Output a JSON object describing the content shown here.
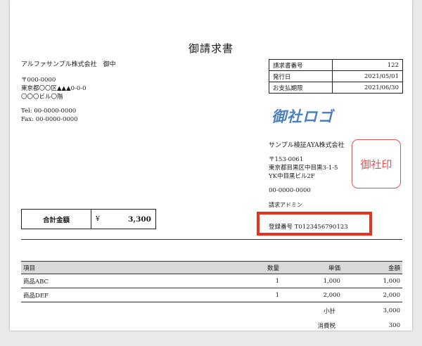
{
  "document": {
    "title": "御請求書",
    "client": {
      "name": "アルファサンプル株式会社　御中",
      "postal": "〒000-0000",
      "address1": "東京都〇〇区▲▲▲0-0-0",
      "address2": "〇〇〇ビル〇階",
      "tel": "Tel: 00-0000-0000",
      "fax": "Fax: 00-0000-0000"
    },
    "meta": [
      {
        "label": "請求書番号",
        "value": "122"
      },
      {
        "label": "発行日",
        "value": "2021/05/01"
      },
      {
        "label": "お支払期限",
        "value": "2021/06/30"
      }
    ],
    "issuer": {
      "logo": "御社ロゴ",
      "name": "サンプル検証AYA株式会社",
      "postal": "〒153-0061",
      "address1": "東京都目黒区中目黒3-1-5",
      "address2": "YK中目黒ビル2F",
      "phone": "00-0000-0000",
      "contact": "請求アドミン",
      "seal": "御社印",
      "registration": "登録番号 T0123456790123"
    },
    "total": {
      "label": "合計金額",
      "currency": "¥",
      "amount": "3,300"
    },
    "items": {
      "headers": [
        "項目",
        "数量",
        "単価",
        "金額"
      ],
      "rows": [
        [
          "商品ABC",
          "1",
          "1,000",
          "1,000"
        ],
        [
          "商品DEF",
          "1",
          "2,000",
          "2,000"
        ]
      ]
    },
    "summary": [
      {
        "label": "小計",
        "value": "3,000"
      },
      {
        "label": "消費税",
        "value": "300"
      }
    ]
  },
  "colors": {
    "highlight_box": "#e8321e",
    "seal": "#d9534f",
    "logo": "#4a7fc0",
    "table_header": "#d9d9d9"
  }
}
